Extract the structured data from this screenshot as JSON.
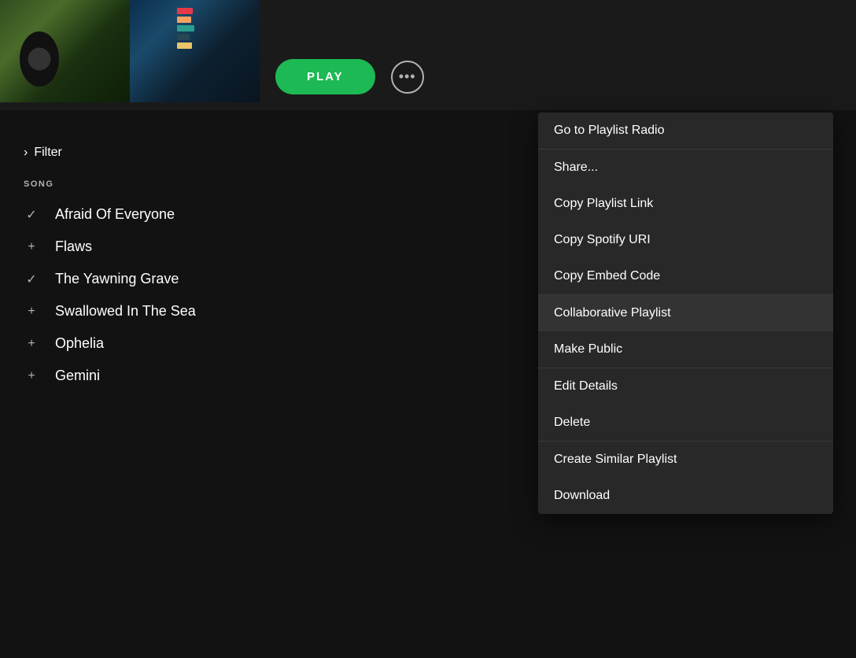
{
  "header": {
    "play_button_label": "PLAY",
    "more_button_label": "···"
  },
  "filter": {
    "label": "Filter",
    "chevron": "‹"
  },
  "song_list": {
    "header": "SONG",
    "songs": [
      {
        "id": 1,
        "name": "Afraid Of Everyone",
        "icon": "✓"
      },
      {
        "id": 2,
        "name": "Flaws",
        "icon": "+"
      },
      {
        "id": 3,
        "name": "The Yawning Grave",
        "icon": "✓"
      },
      {
        "id": 4,
        "name": "Swallowed In The Sea",
        "icon": "+"
      },
      {
        "id": 5,
        "name": "Ophelia",
        "icon": "+"
      },
      {
        "id": 6,
        "name": "Gemini",
        "icon": "+"
      }
    ]
  },
  "context_menu": {
    "sections": [
      {
        "id": "radio",
        "items": [
          {
            "id": "go-to-playlist-radio",
            "label": "Go to Playlist Radio"
          }
        ]
      },
      {
        "id": "share",
        "items": [
          {
            "id": "share",
            "label": "Share..."
          },
          {
            "id": "copy-playlist-link",
            "label": "Copy Playlist Link"
          },
          {
            "id": "copy-spotify-uri",
            "label": "Copy Spotify URI"
          },
          {
            "id": "copy-embed-code",
            "label": "Copy Embed Code"
          }
        ]
      },
      {
        "id": "collab",
        "items": [
          {
            "id": "collaborative-playlist",
            "label": "Collaborative Playlist"
          },
          {
            "id": "make-public",
            "label": "Make Public"
          }
        ]
      },
      {
        "id": "edit",
        "items": [
          {
            "id": "edit-details",
            "label": "Edit Details"
          },
          {
            "id": "delete",
            "label": "Delete"
          }
        ]
      },
      {
        "id": "create",
        "items": [
          {
            "id": "create-similar-playlist",
            "label": "Create Similar Playlist"
          },
          {
            "id": "download",
            "label": "Download"
          }
        ]
      }
    ]
  },
  "album_colors": {
    "bars": [
      {
        "color": "#e63946",
        "width": 20
      },
      {
        "color": "#f4a261",
        "width": 18
      },
      {
        "color": "#2a9d8f",
        "width": 22
      },
      {
        "color": "#264653",
        "width": 16
      },
      {
        "color": "#e9c46a",
        "width": 19
      }
    ]
  }
}
